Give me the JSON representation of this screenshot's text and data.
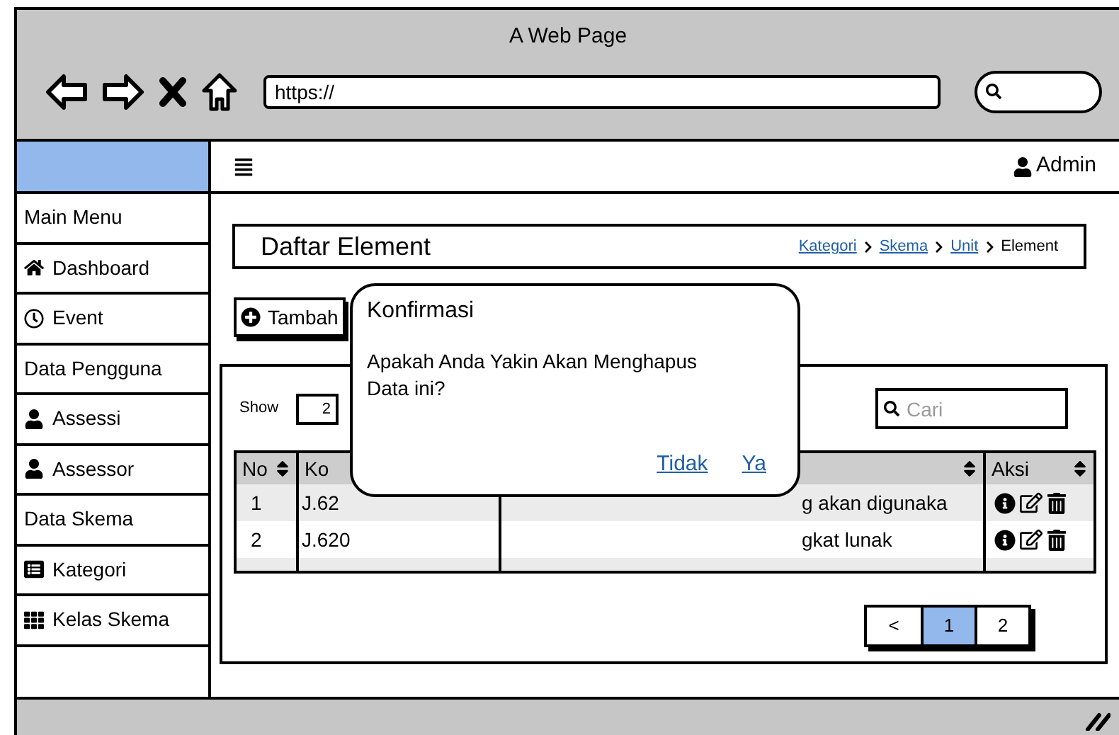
{
  "browser": {
    "title": "A Web Page",
    "url": "https://"
  },
  "header": {
    "user": "Admin"
  },
  "sidebar": {
    "items": [
      {
        "label": "Main Menu",
        "kind": "section"
      },
      {
        "label": "Dashboard",
        "kind": "link"
      },
      {
        "label": "Event",
        "kind": "link"
      },
      {
        "label": "Data Pengguna",
        "kind": "section"
      },
      {
        "label": "Assessi",
        "kind": "link"
      },
      {
        "label": "Assessor",
        "kind": "link"
      },
      {
        "label": "Data Skema",
        "kind": "section"
      },
      {
        "label": "Kategori",
        "kind": "link"
      },
      {
        "label": "Kelas Skema",
        "kind": "link"
      }
    ]
  },
  "page": {
    "title": "Daftar Element",
    "breadcrumb": [
      {
        "label": "Kategori",
        "kind": "link"
      },
      {
        "label": "Skema",
        "kind": "link"
      },
      {
        "label": "Unit",
        "kind": "link"
      },
      {
        "label": "Element",
        "kind": "current"
      }
    ],
    "add_button": "Tambah"
  },
  "table_panel": {
    "show_label": "Show",
    "page_size": "2",
    "search_placeholder": "Cari"
  },
  "table": {
    "columns": [
      {
        "label": "No",
        "sortable": true
      },
      {
        "label": "Ko"
      },
      {
        "sortable": true
      },
      {
        "label": "Aksi",
        "sortable": true
      }
    ],
    "rows": [
      {
        "no": "1",
        "code": "J.62",
        "description": "g akan digunaka"
      },
      {
        "no": "2",
        "code": "J.620",
        "description": "gkat lunak"
      }
    ]
  },
  "pagination": [
    {
      "label": "<",
      "selected": false
    },
    {
      "label": "1",
      "selected": true
    },
    {
      "label": "2",
      "selected": false
    }
  ],
  "dialog": {
    "title": "Konfirmasi",
    "message": "Apakah Anda Yakin Akan Menghapus Data ini?",
    "buttons": [
      "Tidak",
      "Ya"
    ]
  }
}
